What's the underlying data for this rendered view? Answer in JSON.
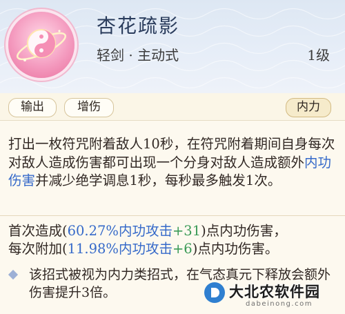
{
  "skill": {
    "name": "杏花疏影",
    "type": "轻剑 · 主动式",
    "level": "1级"
  },
  "tags": {
    "output": "输出",
    "boost": "增伤",
    "category": "内力"
  },
  "description": {
    "part1": "打出一枚符咒附着敌人10秒，在符咒附着期间自身每次对敌人造成伤害都可出现一个分身对敌人造成额外",
    "highlight": "内功伤害",
    "part2": "并减少绝学调息1秒，每秒最多触发1次。"
  },
  "damage": {
    "line1_prefix": "首次造成(",
    "line1_formula": "60.27%内功攻击",
    "line1_bonus": "+31",
    "line1_suffix": ")点内功伤害，",
    "line2_prefix": "每次附加(",
    "line2_formula": "11.98%内功攻击",
    "line2_bonus": "+6",
    "line2_suffix": ")点内功伤害。"
  },
  "note": {
    "text": "该招式被视为内力类招式，在气态真元下释放会额外伤害提升3倍。"
  },
  "watermark": {
    "title": "大北农软件园",
    "subtitle": "dabeinong.com"
  },
  "colors": {
    "accent_blue": "#3569c9",
    "bonus_green": "#3a9a56",
    "icon_pink": "#e96f9c"
  },
  "icons": {
    "skill": "pink-yin-yang-orb-icon",
    "bullet": "diamond-bullet-icon"
  }
}
